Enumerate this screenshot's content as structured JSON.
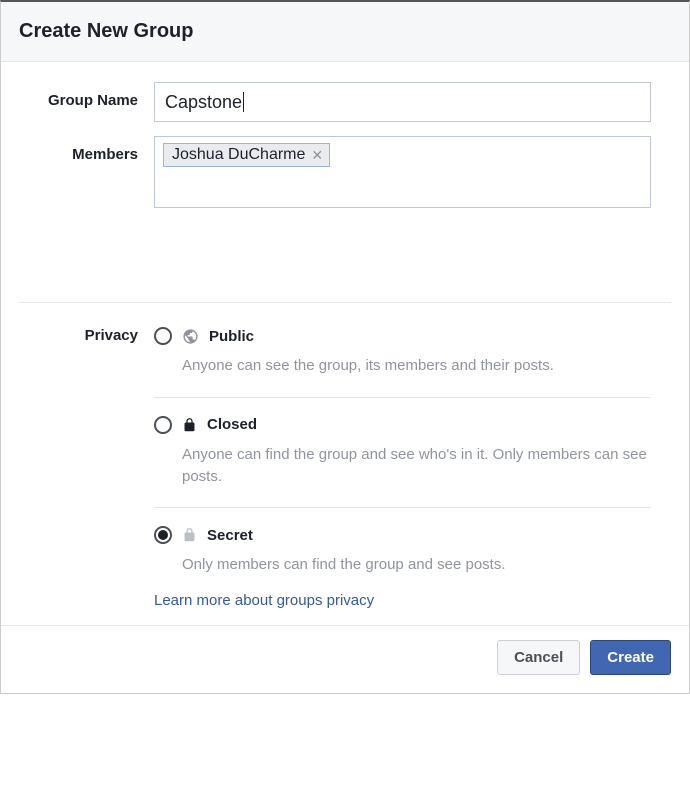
{
  "header": {
    "title": "Create New Group"
  },
  "form": {
    "group_name_label": "Group Name",
    "group_name_value": "Capstone",
    "members_label": "Members",
    "members": [
      {
        "name": "Joshua DuCharme"
      }
    ]
  },
  "privacy": {
    "label": "Privacy",
    "options": [
      {
        "key": "public",
        "icon": "globe-icon",
        "title": "Public",
        "desc": "Anyone can see the group, its members and their posts.",
        "selected": false
      },
      {
        "key": "closed",
        "icon": "lock-icon",
        "title": "Closed",
        "desc": "Anyone can find the group and see who's in it. Only members can see posts.",
        "selected": false
      },
      {
        "key": "secret",
        "icon": "lock-light-icon",
        "title": "Secret",
        "desc": "Only members can find the group and see posts.",
        "selected": true
      }
    ],
    "learn_more": "Learn more about groups privacy"
  },
  "footer": {
    "cancel": "Cancel",
    "create": "Create"
  }
}
